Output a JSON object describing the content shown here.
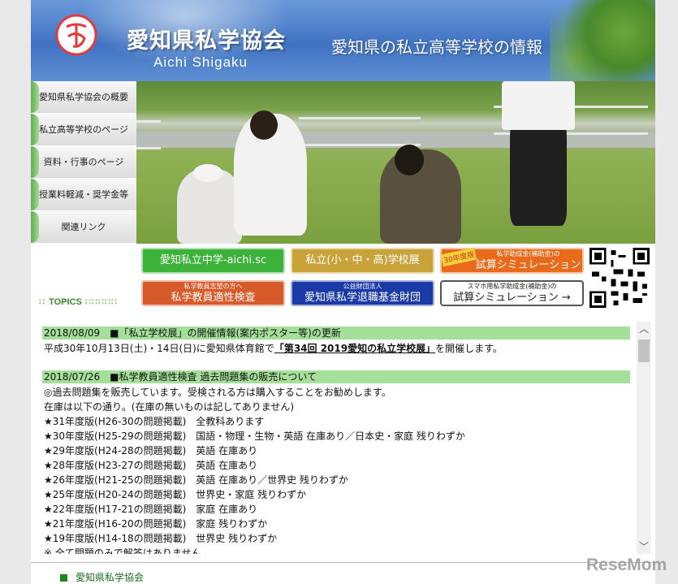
{
  "header": {
    "title": "愛知県私学協会",
    "romaji": "Aichi Shigaku",
    "tagline": "愛知県の私立高等学校の情報"
  },
  "sidenav": {
    "items": [
      {
        "label": "愛知県私学協会の概要"
      },
      {
        "label": "私立高等学校のページ"
      },
      {
        "label": "資料・行事のページ"
      },
      {
        "label": "授業料軽減・奨学金等"
      },
      {
        "label": "関連リンク"
      }
    ]
  },
  "banners": {
    "b1": {
      "main": "愛知私立中学-aichi.sc",
      "color": "#3cb23a"
    },
    "b2": {
      "main": "私立(小・中・高)学校展",
      "color": "#c9a23a"
    },
    "b3": {
      "badge": "30年度版",
      "small": "私学助成金(補助金)の",
      "main": "試算シミュレーション",
      "color": "#e86a1a"
    },
    "b4": {
      "small": "私学教員志望の方へ",
      "main": "私学教員適性検査",
      "color": "#d65a2a"
    },
    "b5": {
      "small": "公益財団法人",
      "main": "愛知県私学退職基金財団",
      "color": "#1b3aa6"
    },
    "b6": {
      "small": "スマホ用私学助成金(補助金)の",
      "main": "試算シミュレーション →"
    }
  },
  "topics_label": "TOPICS",
  "news": [
    {
      "head": "2018/08/09　■「私立学校展」の開催情報(案内ポスター等)の更新",
      "lines": [
        {
          "pre": "平成30年10月13日(土)・14日(日)に愛知県体育館で",
          "link": "「第34回 2019愛知の私立学校展」",
          "post": "を開催します。"
        }
      ]
    },
    {
      "head": "2018/07/26　■私学教員適性検査 過去問題集の販売について",
      "lines": [
        {
          "pre": "◎過去問題集を販売しています。受検される方は購入することをお勧めします。"
        },
        {
          "pre": "在庫は以下の通り。(在庫の無いものは記してありません)"
        },
        {
          "pre": "★31年度版(H26-30の問題掲載)　全教科あります"
        },
        {
          "pre": "★30年度版(H25-29の問題掲載)　国語・物理・生物・英語 在庫あり／日本史・家庭 残りわずか"
        },
        {
          "pre": "★29年度版(H24-28の問題掲載)　英語 在庫あり"
        },
        {
          "pre": "★28年度版(H23-27の問題掲載)　英語 在庫あり"
        },
        {
          "pre": "★26年度版(H21-25の問題掲載)　英語 在庫あり／世界史 残りわずか"
        },
        {
          "pre": "★25年度版(H20-24の問題掲載)　世界史・家庭 残りわずか"
        },
        {
          "pre": "★22年度版(H17-21の問題掲載)　家庭 在庫あり"
        },
        {
          "pre": "★21年度版(H16-20の問題掲載)　家庭 残りわずか"
        },
        {
          "pre": "★19年度版(H14-18の問題掲載)　世界史 残りわずか"
        },
        {
          "pre": "※ 全て問題のみで解答はありません"
        }
      ]
    }
  ],
  "footer": {
    "label": "愛知県私学協会"
  },
  "watermark": "ReseMom"
}
